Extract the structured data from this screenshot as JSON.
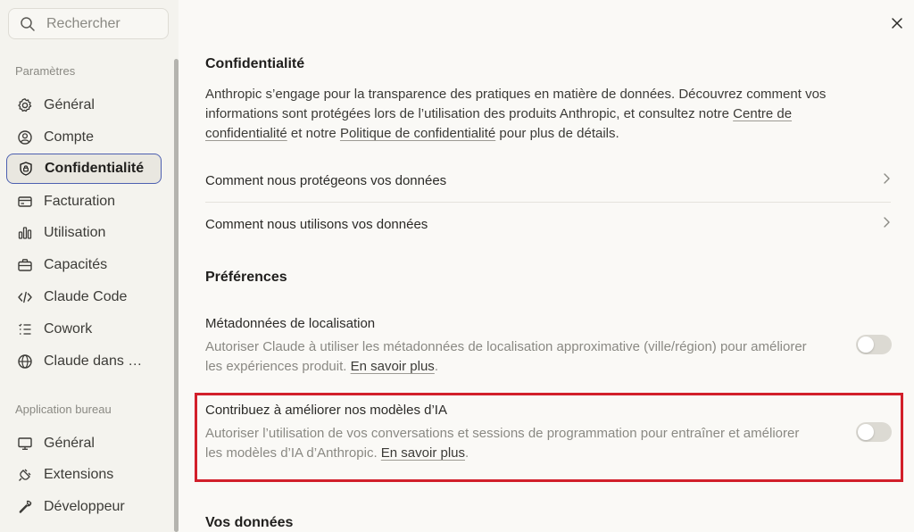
{
  "sidebar": {
    "search_placeholder": "Rechercher",
    "settings_title": "Paramètres",
    "items": [
      {
        "label": "Général",
        "icon": "gear-icon"
      },
      {
        "label": "Compte",
        "icon": "user-circle-icon"
      },
      {
        "label": "Confidentialité",
        "icon": "shield-icon",
        "active": true
      },
      {
        "label": "Facturation",
        "icon": "credit-card-icon"
      },
      {
        "label": "Utilisation",
        "icon": "bar-chart-icon"
      },
      {
        "label": "Capacités",
        "icon": "toolbox-icon"
      },
      {
        "label": "Claude Code",
        "icon": "code-icon"
      },
      {
        "label": "Cowork",
        "icon": "list-icon"
      },
      {
        "label": "Claude dans …",
        "icon": "globe-icon"
      }
    ],
    "desktop_title": "Application bureau",
    "desktop_items": [
      {
        "label": "Général",
        "icon": "monitor-icon"
      },
      {
        "label": "Extensions",
        "icon": "plug-icon"
      },
      {
        "label": "Développeur",
        "icon": "wrench-icon"
      }
    ]
  },
  "privacy": {
    "title": "Confidentialité",
    "desc_part1": "Anthropic s’engage pour la transparence des pratiques en matière de données. Découvrez comment vos informations sont protégées lors de l’utilisation des produits Anthropic, et consultez notre ",
    "link_center": "Centre de confidentialité",
    "desc_part2": " et notre ",
    "link_policy": "Politique de confidentialité",
    "desc_part3": " pour plus de détails.",
    "row1": "Comment nous protégeons vos données",
    "row2": "Comment nous utilisons vos données"
  },
  "preferences": {
    "title": "Préférences",
    "location_title": "Métadonnées de localisation",
    "location_desc": "Autoriser Claude à utiliser les métadonnées de localisation approximative (ville/région) pour améliorer les expériences produit. ",
    "location_link": "En savoir plus",
    "location_enabled": false,
    "improve_title": "Contribuez à améliorer nos modèles d’IA",
    "improve_desc": "Autoriser l’utilisation de vos conversations et sessions de programmation pour entraîner et améliorer les modèles d’IA d’Anthropic. ",
    "improve_link": "En savoir plus",
    "improve_enabled": false
  },
  "data_section": {
    "title": "Vos données"
  },
  "colors": {
    "active_border": "#4c5fb0",
    "highlight": "#d21f2a"
  }
}
